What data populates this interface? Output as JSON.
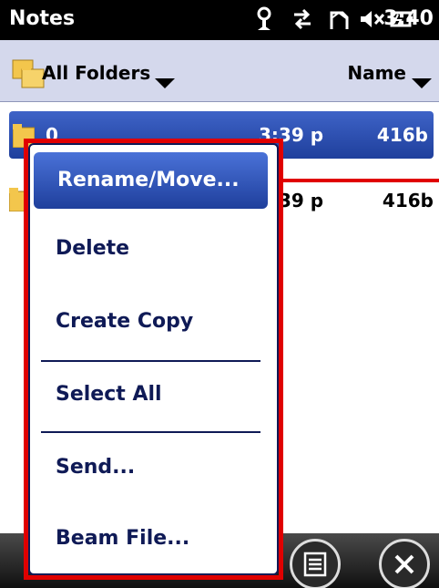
{
  "statusbar": {
    "app_title": "Notes",
    "clock": "3:40",
    "icons": [
      "signal-icon",
      "sync-icon",
      "connection-icon",
      "volume-muted-icon",
      "battery-icon"
    ]
  },
  "folder_header": {
    "folder_label": "All Folders",
    "sort_label": "Name"
  },
  "list": {
    "rows": [
      {
        "name": "0",
        "time": "3:39 p",
        "size": "416b",
        "selected": true
      },
      {
        "name": "",
        "time": "39 p",
        "size": "416b",
        "selected": false
      }
    ]
  },
  "context_menu": {
    "items": [
      {
        "label": "Rename/Move...",
        "active": true
      },
      {
        "label": "Delete"
      },
      {
        "label": "Create Copy"
      },
      {
        "label": "Select All"
      },
      {
        "label": "Send..."
      },
      {
        "label": "Beam File..."
      }
    ]
  },
  "colors": {
    "accent": "#1f3f9c",
    "highlight": "#e00000",
    "menu_text": "#0f1a56",
    "header_bg": "#d4d8ec"
  }
}
